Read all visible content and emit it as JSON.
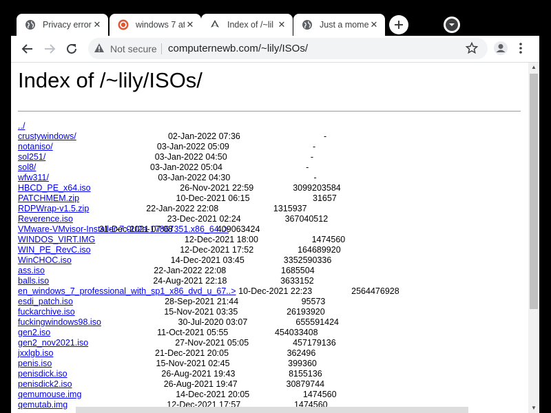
{
  "tabs": [
    {
      "title": "Privacy error",
      "icon": "globe-icon",
      "active": false
    },
    {
      "title": "windows 7 at",
      "icon": "duckduckgo-icon",
      "active": false
    },
    {
      "title": "Index of /~lil",
      "icon": "loading-icon",
      "active": true
    },
    {
      "title": "Just a mome",
      "icon": "globe-icon",
      "active": false
    }
  ],
  "toolbar": {
    "not_secure": "Not secure",
    "url": "computernewb.com/~lily/ISOs/"
  },
  "page": {
    "heading": "Index of /~lily/ISOs/",
    "entries": [
      {
        "name": "../",
        "date": "",
        "size": ""
      },
      {
        "name": "crustywindows/",
        "date": "02-Jan-2022 07:36",
        "size": "-"
      },
      {
        "name": "notaniso/",
        "date": "03-Jan-2022 05:09",
        "size": "-"
      },
      {
        "name": "sol251/",
        "date": "03-Jan-2022 04:50",
        "size": "-"
      },
      {
        "name": "sol8/",
        "date": "03-Jan-2022 05:04",
        "size": "-"
      },
      {
        "name": "wfw311/",
        "date": "03-Jan-2022 04:30",
        "size": "-"
      },
      {
        "name": "HBCD_PE_x64.iso",
        "date": "26-Nov-2021 22:59",
        "size": "3099203584"
      },
      {
        "name": "PATCHMEM.zip",
        "date": "10-Dec-2021 06:15",
        "size": "31657"
      },
      {
        "name": "RDPWrap-v1.5.zip",
        "date": "22-Jan-2022 22:08",
        "size": "1315937"
      },
      {
        "name": "Reverence.iso",
        "date": "23-Dec-2021 02:24",
        "size": "367040512"
      },
      {
        "name": "VMware-VMvisor-Installer-7.0U2a-17867351.x86_64..>",
        "date": "31-Dec-2021 07:08",
        "size": "409063424"
      },
      {
        "name": "WINDOS_VIRT.IMG",
        "date": "12-Dec-2021 18:00",
        "size": "1474560"
      },
      {
        "name": "WIN_PE_RevC.iso",
        "date": "12-Dec-2021 17:52",
        "size": "164689920"
      },
      {
        "name": "WinCHOC.iso",
        "date": "14-Dec-2021 03:45",
        "size": "3352590336"
      },
      {
        "name": "ass.iso",
        "date": "22-Jan-2022 22:08",
        "size": "1685504"
      },
      {
        "name": "balls.iso",
        "date": "24-Aug-2021 22:18",
        "size": "3633152"
      },
      {
        "name": "en_windows_7_professional_with_sp1_x86_dvd_u_67..>",
        "date": "10-Dec-2021 22:23",
        "size": "2564476928"
      },
      {
        "name": "esdi_patch.iso",
        "date": "28-Sep-2021 21:44",
        "size": "95573"
      },
      {
        "name": "fuckarchive.iso",
        "date": "15-Nov-2021 03:35",
        "size": "26193920"
      },
      {
        "name": "fuckingwindows98.iso",
        "date": "30-Jul-2020 03:07",
        "size": "655591424"
      },
      {
        "name": "gen2.iso",
        "date": "11-Oct-2021 05:55",
        "size": "454033408"
      },
      {
        "name": "gen2_nov2021.iso",
        "date": "27-Nov-2021 05:05",
        "size": "457179136"
      },
      {
        "name": "jxxlgb.iso",
        "date": "21-Dec-2021 20:05",
        "size": "362496"
      },
      {
        "name": "penis.iso",
        "date": "15-Nov-2021 02:45",
        "size": "399360"
      },
      {
        "name": "penisdick.iso",
        "date": "26-Aug-2021 19:43",
        "size": "8155136"
      },
      {
        "name": "penisdick2.iso",
        "date": "26-Aug-2021 19:47",
        "size": "30879744"
      },
      {
        "name": "qemumouse.img",
        "date": "14-Dec-2021 20:05",
        "size": "1474560"
      },
      {
        "name": "qemutab.img",
        "date": "12-Dec-2021 17:57",
        "size": "1474560"
      }
    ]
  },
  "colors": {
    "link": "#0000ee",
    "chrome_bg": "#000000",
    "omnibox_bg": "#f1f3f4"
  }
}
